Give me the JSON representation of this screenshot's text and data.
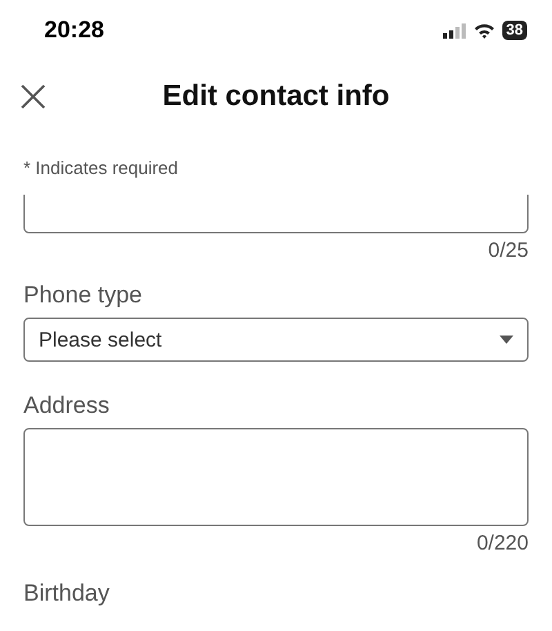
{
  "status_bar": {
    "time": "20:28",
    "battery": "38"
  },
  "header": {
    "title": "Edit contact info"
  },
  "note": "* Indicates required",
  "fields": [
    {
      "kind": "text",
      "counter": "0/25"
    },
    {
      "kind": "select",
      "label": "Phone type",
      "value": "Please select"
    },
    {
      "kind": "textarea",
      "label": "Address",
      "counter": "0/220"
    },
    {
      "kind": "heading",
      "label": "Birthday"
    }
  ]
}
